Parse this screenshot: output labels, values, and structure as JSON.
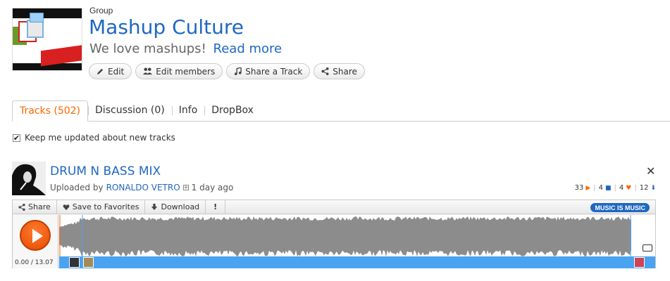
{
  "group": {
    "label": "Group",
    "title": "Mashup Culture",
    "description": "We love mashups!",
    "read_more": "Read more",
    "actions": [
      {
        "label": "Edit",
        "icon": "pencil-icon"
      },
      {
        "label": "Edit members",
        "icon": "users-icon"
      },
      {
        "label": "Share a Track",
        "icon": "music-note-icon"
      },
      {
        "label": "Share",
        "icon": "share-icon"
      }
    ]
  },
  "tabs": [
    {
      "label": "Tracks (502)",
      "active": true
    },
    {
      "label": "Discussion (0)",
      "active": false
    },
    {
      "label": "Info",
      "active": false
    },
    {
      "label": "DropBox",
      "active": false
    }
  ],
  "keep_updated": {
    "label": "Keep me updated about new tracks",
    "checked": true
  },
  "track": {
    "title": "DRUM N BASS MIX",
    "uploaded_by_label": "Uploaded by",
    "uploader": "RONALDO VETRO",
    "age": "1 day ago",
    "close": "✕",
    "stats": {
      "plays": "33",
      "comments": "4",
      "favorites": "4",
      "downloads": "12"
    },
    "toolbar": {
      "share": "Share",
      "favorites": "Save to Favorites",
      "download": "Download",
      "report": "!"
    },
    "genre_badge": "MUSIC IS MUSIC",
    "time": "0.00 / 13.07"
  },
  "colors": {
    "link": "#1f67c2",
    "active_tab": "#ff6600",
    "play_button": "#e64b00",
    "waveform": "#8c8c8c",
    "progress_bar": "#4aa3f0"
  }
}
